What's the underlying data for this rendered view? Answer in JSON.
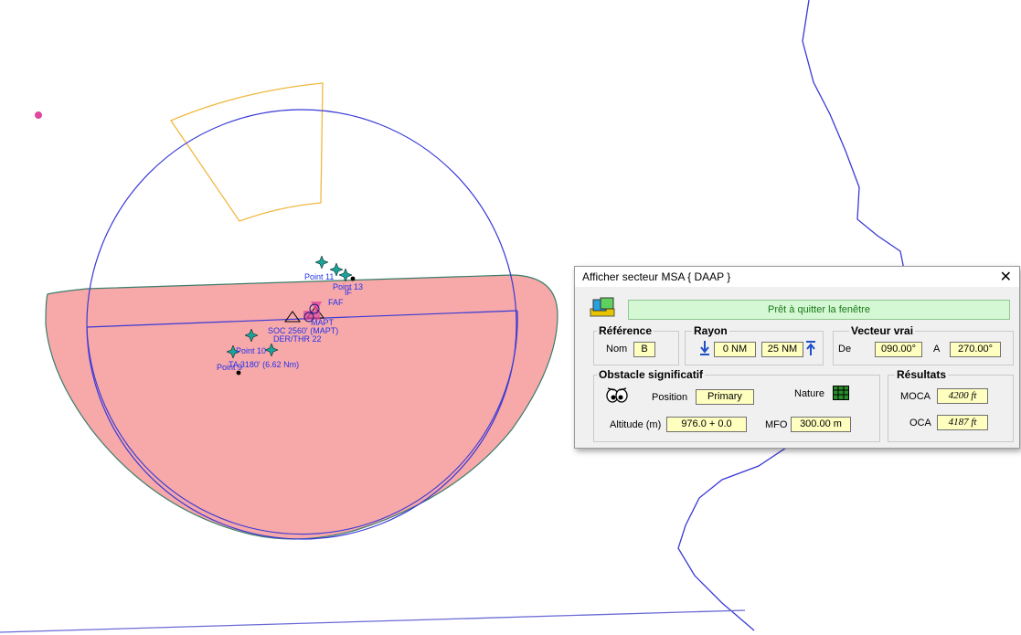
{
  "dialog": {
    "title": "Afficher secteur MSA { DAAP }",
    "close_icon": "close-icon",
    "status_text": "Prêt à quitter la fenêtre",
    "reference": {
      "title": "Référence",
      "nom_label": "Nom",
      "nom_value": "B"
    },
    "rayon": {
      "title": "Rayon",
      "min_value": "0 NM",
      "max_value": "25 NM"
    },
    "vecteur": {
      "title": "Vecteur vrai",
      "de_label": "De",
      "de_value": "090.00°",
      "a_label": "A",
      "a_value": "270.00°"
    },
    "obstacle": {
      "title": "Obstacle significatif",
      "position_label": "Position",
      "position_value": "Primary",
      "nature_label": "Nature",
      "altitude_label": "Altitude (m)",
      "altitude_value": "976.0 + 0.0",
      "mfo_label": "MFO",
      "mfo_value": "300.00 m"
    },
    "resultats": {
      "title": "Résultats",
      "moca_label": "MOCA",
      "moca_value": "4200 ft",
      "oca_label": "OCA",
      "oca_value": "4187 ft"
    }
  },
  "map": {
    "labels": {
      "point11": "Point 11",
      "point13": "Point 13",
      "if": "IF",
      "faf": "FAF",
      "mapt": "MAPT",
      "soc": "SOC 2560' (MAPT)",
      "der": "DER/THR 22",
      "point10": "Point 10",
      "point9": "Point 9",
      "ta": "TA 3180' (6.62 Nm)"
    },
    "colors": {
      "sector_fill": "#f7a8a8",
      "circle": "#3a3ad6",
      "arc": "#f0b840",
      "border": "#3a3ad6",
      "fix": "#1aa39a"
    }
  }
}
